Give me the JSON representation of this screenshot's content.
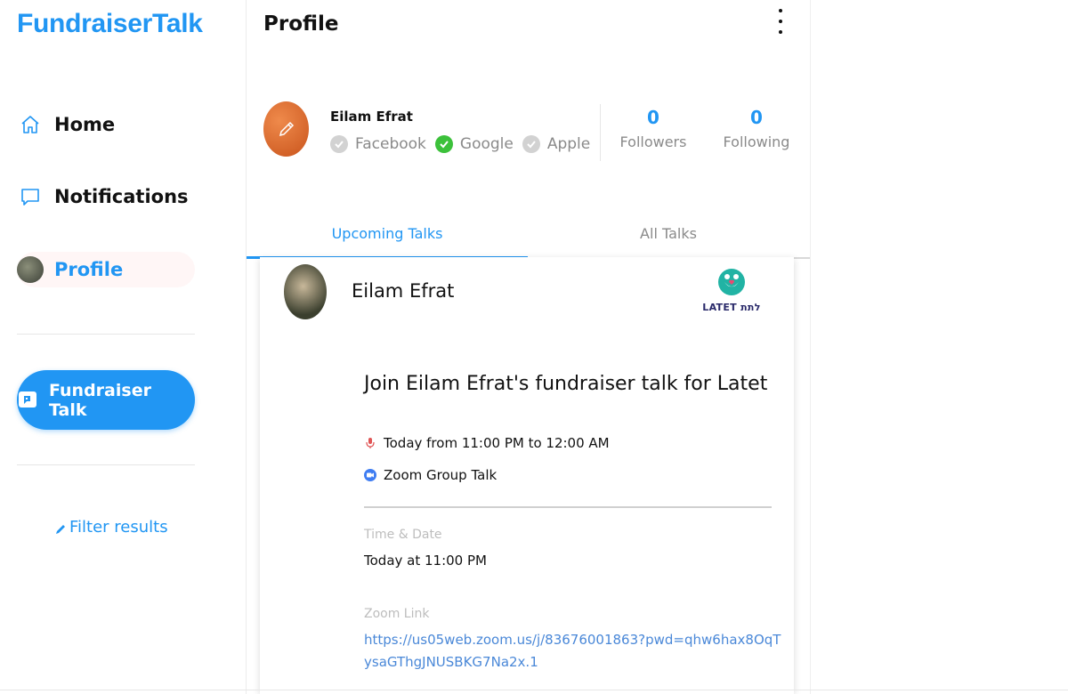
{
  "app": {
    "brand": "FundraiserTalk"
  },
  "sidebar": {
    "items": [
      {
        "label": "Home",
        "icon": "home-icon"
      },
      {
        "label": "Notifications",
        "icon": "message-icon"
      },
      {
        "label": "Profile",
        "icon": "avatar"
      }
    ],
    "action_button": "Fundraiser Talk",
    "filter_link": "Filter results"
  },
  "header": {
    "title": "Profile"
  },
  "profile": {
    "name": "Eilam Efrat",
    "providers": [
      {
        "name": "Facebook",
        "connected": false
      },
      {
        "name": "Google",
        "connected": true
      },
      {
        "name": "Apple",
        "connected": false
      }
    ],
    "followers_count": "0",
    "followers_label": "Followers",
    "following_count": "0",
    "following_label": "Following"
  },
  "tabs": [
    {
      "label": "Upcoming Talks",
      "active": true
    },
    {
      "label": "All Talks",
      "active": false
    }
  ],
  "talk": {
    "host_name": "Eilam Efrat",
    "org_logo_text": "LATET לתת",
    "title": "Join Eilam Efrat's fundraiser talk for Latet",
    "time_text": "Today from 11:00 PM to 12:00 AM",
    "type_text": "Zoom Group Talk",
    "time_date_label": "Time & Date",
    "time_date_value": "Today at 11:00 PM",
    "zoom_link_label": "Zoom Link",
    "zoom_link": "https://us05web.zoom.us/j/83676001863?pwd=qhw6hax8OqTysaGThgJNUSBKG7Na2x.1"
  },
  "colors": {
    "accent": "#2196f3",
    "check_on": "#3cc13b",
    "check_off": "#d2d2d2",
    "link": "#4a88d8",
    "latet_teal": "#21b3a4"
  }
}
